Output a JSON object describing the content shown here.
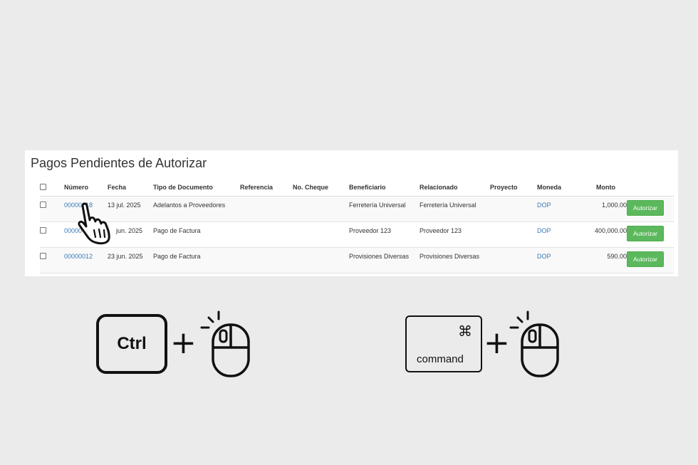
{
  "panel": {
    "title": "Pagos Pendientes de Autorizar"
  },
  "table": {
    "headers": [
      "Número",
      "Fecha",
      "Tipo de Documento",
      "Referencia",
      "No. Cheque",
      "Beneficiario",
      "Relacionado",
      "Proyecto",
      "Moneda",
      "Monto"
    ],
    "rows": [
      {
        "numero": "00000018",
        "fecha": "13 jul. 2025",
        "tipo": "Adelantos a Proveedores",
        "referencia": "",
        "cheque": "",
        "beneficiario": "Ferretería Universal",
        "relacionado": "Ferretería Universal",
        "proyecto": "",
        "moneda": "DOP",
        "monto": "1,000.00",
        "action": "Autorizar"
      },
      {
        "numero": "00000",
        "fecha": "jun. 2025",
        "tipo": "Pago de Factura",
        "referencia": "",
        "cheque": "",
        "beneficiario": "Proveedor 123",
        "relacionado": "Proveedor 123",
        "proyecto": "",
        "moneda": "DOP",
        "monto": "400,000.00",
        "action": "Autorizar"
      },
      {
        "numero": "00000012",
        "fecha": "23 jun. 2025",
        "tipo": "Pago de Factura",
        "referencia": "",
        "cheque": "",
        "beneficiario": "Provisiones Diversas",
        "relacionado": "Provisiones Diversas",
        "proyecto": "",
        "moneda": "DOP",
        "monto": "590.00",
        "action": "Autorizar"
      }
    ]
  },
  "shortcuts": {
    "windows_key": "Ctrl",
    "mac_key_symbol": "⌘",
    "mac_key": "command",
    "plus": "+"
  },
  "colors": {
    "background": "#ebebeb",
    "link": "#3a78b5",
    "button": "#5cb85c"
  }
}
